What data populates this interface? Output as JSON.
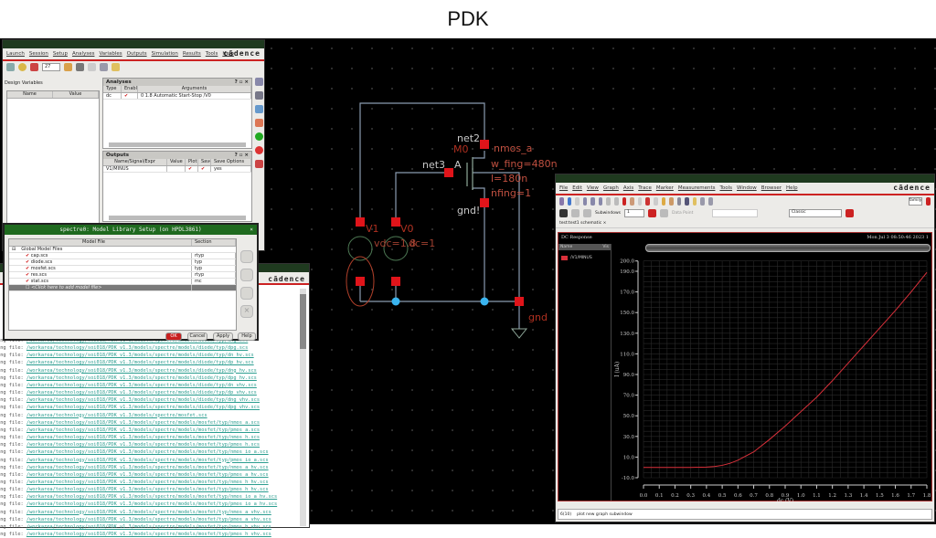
{
  "slide": {
    "title": "PDK"
  },
  "ade": {
    "menu": [
      "Launch",
      "Session",
      "Setup",
      "Analyses",
      "Variables",
      "Outputs",
      "Simulation",
      "Results",
      "Tools",
      "Help"
    ],
    "brand": "cādence",
    "temp": "27",
    "design_vars": {
      "title": "Design Variables",
      "cols": [
        "Name",
        "Value"
      ]
    },
    "analyses": {
      "title": "Analyses",
      "cols": [
        "Type",
        "Enable",
        "Arguments"
      ],
      "rows": [
        {
          "type": "dc",
          "enable": "✔",
          "args": "0 1.8 Automatic Start-Stop /V0"
        }
      ]
    },
    "outputs": {
      "title": "Outputs",
      "cols": [
        "Name/Signal/Expr",
        "Value",
        "Plot",
        "Save",
        "Save Options"
      ],
      "rows": [
        {
          "name": "V1/MINUS",
          "value": "",
          "plot": "✔",
          "save": "✔",
          "opts": "yes"
        }
      ]
    },
    "panel_ctrl": "? ▫ ×"
  },
  "model_dialog": {
    "title": "spectre0: Model Library Setup (on HPDL3861)",
    "cols": [
      "Model File",
      "Section"
    ],
    "group": "Global Model Files",
    "rows": [
      {
        "file": "cap.scs",
        "section": "rtyp"
      },
      {
        "file": "diode.scs",
        "section": "typ"
      },
      {
        "file": "mosfet.scs",
        "section": "typ"
      },
      {
        "file": "res.scs",
        "section": "rtyp"
      },
      {
        "file": "stat.scs",
        "section": "mc"
      }
    ],
    "add_row": "<Click here to add model file>",
    "buttons": {
      "ok": "OK",
      "cancel": "Cancel",
      "apply": "Apply",
      "help": "Help"
    }
  },
  "log": {
    "brand": "cādence",
    "prefix": "ing file:",
    "lines": [
      "/workarea/technology/soi018/PDK_v1.3/models/spectre/models/diode/typ/dng.scs",
      "/workarea/technology/soi018/PDK_v1.3/models/spectre/models/diode/typ/dpg.scs",
      "/workarea/technology/soi018/PDK_v1.3/models/spectre/models/diode/typ/dn_hv.scs",
      "/workarea/technology/soi018/PDK_v1.3/models/spectre/models/diode/typ/dp_hv.scs",
      "/workarea/technology/soi018/PDK_v1.3/models/spectre/models/diode/typ/dng_hv.scs",
      "/workarea/technology/soi018/PDK_v1.3/models/spectre/models/diode/typ/dpg_hv.scs",
      "/workarea/technology/soi018/PDK_v1.3/models/spectre/models/diode/typ/dn_vhv.scs",
      "/workarea/technology/soi018/PDK_v1.3/models/spectre/models/diode/typ/dp_vhv.scs",
      "/workarea/technology/soi018/PDK_v1.3/models/spectre/models/diode/typ/dng_vhv.scs",
      "/workarea/technology/soi018/PDK_v1.3/models/spectre/models/diode/typ/dpg_vhv.scs",
      "/workarea/technology/soi018/PDK_v1.3/models/spectre/mosfet.scs",
      "/workarea/technology/soi018/PDK_v1.3/models/spectre/models/mosfet/typ/nmos_a.scs",
      "/workarea/technology/soi018/PDK_v1.3/models/spectre/models/mosfet/typ/pmos_a.scs",
      "/workarea/technology/soi018/PDK_v1.3/models/spectre/models/mosfet/typ/nmos_h.scs",
      "/workarea/technology/soi018/PDK_v1.3/models/spectre/models/mosfet/typ/pmos_h.scs",
      "/workarea/technology/soi018/PDK_v1.3/models/spectre/models/mosfet/typ/nmos_io_a.scs",
      "/workarea/technology/soi018/PDK_v1.3/models/spectre/models/mosfet/typ/pmos_io_a.scs",
      "/workarea/technology/soi018/PDK_v1.3/models/spectre/models/mosfet/typ/nmos_a_hv.scs",
      "/workarea/technology/soi018/PDK_v1.3/models/spectre/models/mosfet/typ/pmos_a_hv.scs",
      "/workarea/technology/soi018/PDK_v1.3/models/spectre/models/mosfet/typ/nmos_h_hv.scs",
      "/workarea/technology/soi018/PDK_v1.3/models/spectre/models/mosfet/typ/pmos_h_hv.scs",
      "/workarea/technology/soi018/PDK_v1.3/models/spectre/models/mosfet/typ/nmos_io_a_hv.scs",
      "/workarea/technology/soi018/PDK_v1.3/models/spectre/models/mosfet/typ/pmos_io_a_hv.scs",
      "/workarea/technology/soi018/PDK_v1.3/models/spectre/models/mosfet/typ/nmos_a_vhv.scs",
      "/workarea/technology/soi018/PDK_v1.3/models/spectre/models/mosfet/typ/pmos_a_vhv.scs",
      "/workarea/technology/soi018/PDK_v1.3/models/spectre/models/mosfet/typ/nmos_h_vhv.scs",
      "/workarea/technology/soi018/PDK_v1.3/models/spectre/models/mosfet/typ/pmos_h_vhv.scs"
    ]
  },
  "schematic": {
    "net2": "net2",
    "m0": "M0",
    "model": "nmos_a",
    "net3": "net3",
    "pin_a": "A",
    "w": "w_fing=480n",
    "l": "l=180n",
    "nf": "nfing=1",
    "gndb": "gnd!",
    "v1": "V1",
    "v0": "V0",
    "vdc": "vdc=1.8",
    "dc": "dc=1",
    "gnd": "gnd"
  },
  "wave": {
    "menu": [
      "File",
      "Edit",
      "View",
      "Graph",
      "Axis",
      "Trace",
      "Marker",
      "Measurements",
      "Tools",
      "Window",
      "Browser",
      "Help"
    ],
    "brand": "cādence",
    "family": "family",
    "subwindows_label": "Subwindows",
    "subwindows_value": "1",
    "data_point": "Data Point",
    "style": "Classic",
    "tab": "test:test1 schematic",
    "plot_title": "DC Response",
    "timestamp": "Mon Jul 3 08:50:46 2023  1",
    "legend_cols": [
      "Name",
      "Vis"
    ],
    "status_num": "6(10)",
    "status_msg": "plot new graph subwindow",
    "colors": {
      "trace": "#d9303a",
      "bg": "#000000"
    }
  },
  "chart_data": {
    "type": "line",
    "title": "DC Response",
    "xlabel": "dc (V)",
    "ylabel": "I (uA)",
    "xlim": [
      0,
      1.8
    ],
    "ylim": [
      -10,
      200
    ],
    "xticks": [
      "0.0",
      "0.1",
      "0.2",
      "0.3",
      "0.4",
      "0.5",
      "0.6",
      "0.7",
      "0.8",
      "0.9",
      "1.0",
      "1.1",
      "1.2",
      "1.3",
      "1.4",
      "1.5",
      "1.6",
      "1.7",
      "1.8"
    ],
    "yticks": [
      "200.0",
      "190.0",
      "170.0",
      "150.0",
      "130.0",
      "110.0",
      "90.0",
      "70.0",
      "50.0",
      "30.0",
      "10.0",
      "-10.0"
    ],
    "series": [
      {
        "name": "/V1/MINUS",
        "x": [
          0,
          0.1,
          0.2,
          0.3,
          0.4,
          0.45,
          0.5,
          0.55,
          0.6,
          0.7,
          0.8,
          0.9,
          1.0,
          1.1,
          1.2,
          1.3,
          1.4,
          1.5,
          1.6,
          1.7,
          1.8
        ],
        "y": [
          0,
          0,
          0,
          0,
          0.3,
          0.8,
          2,
          4,
          7,
          15,
          27,
          40,
          54,
          68,
          84,
          101,
          118,
          135,
          152,
          170,
          189
        ]
      }
    ]
  }
}
